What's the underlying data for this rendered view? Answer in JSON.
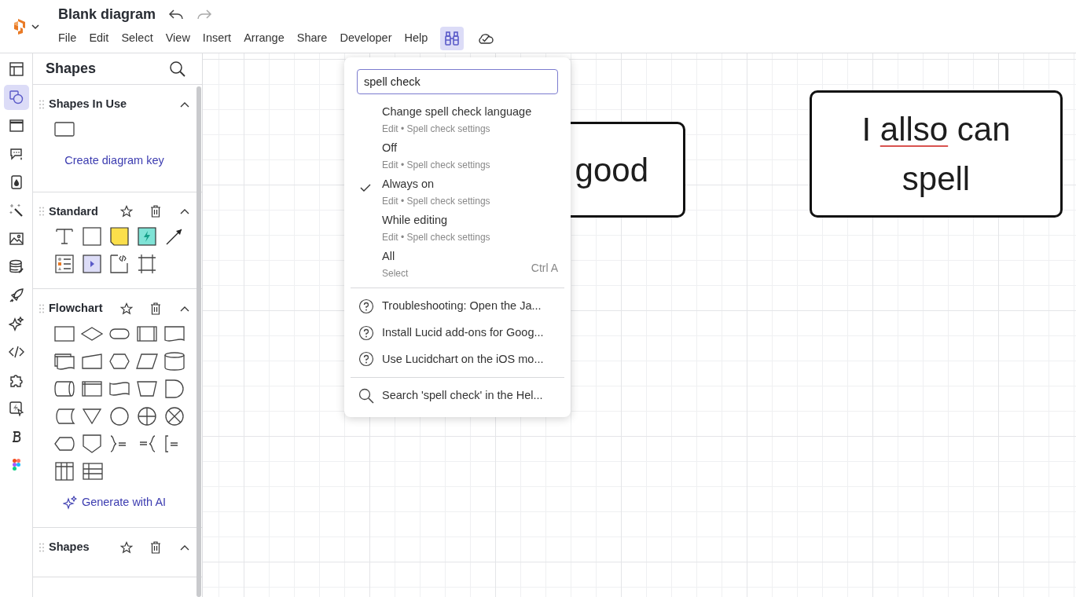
{
  "header": {
    "title": "Blank diagram",
    "menus": [
      "File",
      "Edit",
      "Select",
      "View",
      "Insert",
      "Arrange",
      "Share",
      "Developer",
      "Help"
    ],
    "find_button": {
      "selected": true
    }
  },
  "rail": [
    {
      "selected": false
    },
    {
      "selected": true
    },
    {
      "selected": false
    },
    {
      "selected": false
    },
    {
      "selected": false
    },
    {
      "selected": false
    },
    {
      "selected": false
    },
    {
      "selected": false
    },
    {
      "selected": false
    },
    {
      "selected": false
    },
    {
      "selected": false
    },
    {
      "selected": false
    },
    {
      "selected": false
    },
    {
      "selected": false
    },
    {
      "selected": false
    }
  ],
  "panel": {
    "title": "Shapes",
    "sections": [
      {
        "title": "Shapes In Use",
        "kind": "in_use",
        "link": "Create diagram key"
      },
      {
        "title": "Standard",
        "kind": "library"
      },
      {
        "title": "Flowchart",
        "kind": "library",
        "link": "Generate with AI"
      },
      {
        "title": "Shapes",
        "kind": "library"
      }
    ]
  },
  "canvas": {
    "shapes": [
      {
        "segments": [
          {
            "text": "good",
            "misspelled": false
          }
        ]
      },
      {
        "segments": [
          {
            "text": "I ",
            "misspelled": false
          },
          {
            "text": "allso",
            "misspelled": true
          },
          {
            "text": " can spell",
            "misspelled": false
          }
        ]
      }
    ]
  },
  "command_menu": {
    "query": "spell check",
    "commands": [
      {
        "label": "Change spell check language",
        "path": "Edit • Spell check settings",
        "checked": false
      },
      {
        "label": "Off",
        "path": "Edit • Spell check settings",
        "checked": false
      },
      {
        "label": "Always on",
        "path": "Edit • Spell check settings",
        "checked": true
      },
      {
        "label": "While editing",
        "path": "Edit • Spell check settings",
        "checked": false
      },
      {
        "label": "All",
        "path": "Select",
        "checked": false,
        "shortcut": "Ctrl A"
      }
    ],
    "help_articles": [
      "Troubleshooting: Open the Ja...",
      "Install Lucid add-ons for Goog...",
      "Use Lucidchart on the iOS mo..."
    ],
    "help_search": "Search 'spell check' in the Hel..."
  }
}
